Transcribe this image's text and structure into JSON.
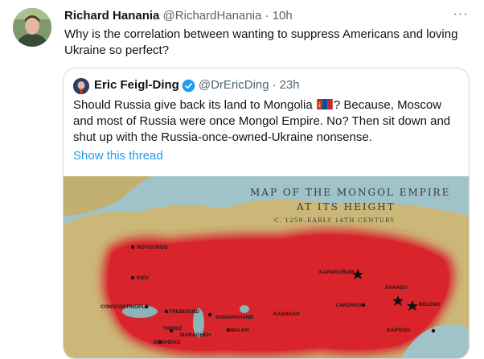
{
  "tweet": {
    "author_name": "Richard Hanania",
    "author_handle": "@RichardHanania",
    "separator": "·",
    "time": "10h",
    "more_label": "···",
    "text": "Why is the correlation between wanting to suppress Americans and loving Ukraine so perfect?"
  },
  "quote": {
    "author_name": "Eric Feigl-Ding",
    "author_handle": "@DrEricDing",
    "separator": "·",
    "time": "23h",
    "text_before_flag": "Should Russia give back its land to Mongolia ",
    "text_after_flag": "? Because, Moscow and most of Russia were once Mongol Empire. No? Then sit down  and shut up with the Russia-once-owned-Ukraine nonsense.",
    "show_thread": "Show this thread",
    "map": {
      "title_line1": "MAP OF THE MONGOL EMPIRE",
      "title_line2": "AT ITS HEIGHT",
      "title_line3": "C. 1259–EARLY 14TH CENTURY",
      "cities": [
        "NOVGOROD",
        "KIEV",
        "CONSTANTINOPLE",
        "TREBIZOND",
        "SAMARKHAND",
        "KASHGAR",
        "TABRIZ",
        "MARAGHEH",
        "BALKH",
        "KARAKORUM",
        "XANADU",
        "LANZHOU",
        "BEIJING",
        "KAIFENG",
        "BAGHDAD"
      ]
    }
  },
  "colors": {
    "link": "#1d9bf0",
    "verified": "#1d9bf0",
    "empire_red": "#d8242a",
    "land": "#cbb878",
    "sea": "#9fc3c9"
  }
}
